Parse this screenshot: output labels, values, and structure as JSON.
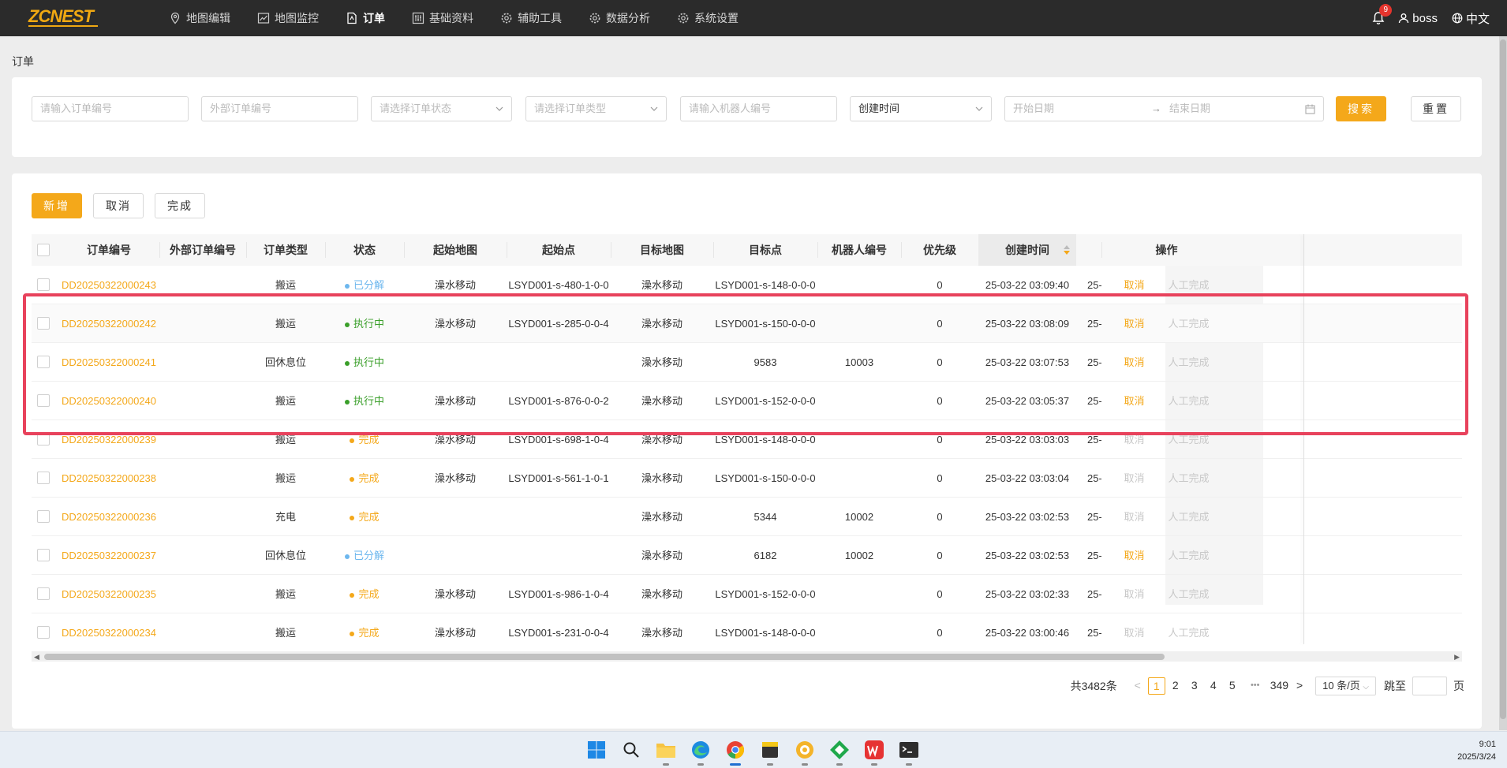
{
  "app": {
    "logo_text": "ZCNEST",
    "brand_color": "#f4a81a"
  },
  "nav": [
    {
      "label": "地图编辑",
      "icon": "map-pin-icon"
    },
    {
      "label": "地图监控",
      "icon": "chart-line-icon"
    },
    {
      "label": "订单",
      "icon": "document-icon",
      "active": true
    },
    {
      "label": "基础资料",
      "icon": "sliders-icon"
    },
    {
      "label": "辅助工具",
      "icon": "gear-icon"
    },
    {
      "label": "数据分析",
      "icon": "gear-icon"
    },
    {
      "label": "系统设置",
      "icon": "gear-icon"
    }
  ],
  "header_right": {
    "notif_count": "9",
    "user": "boss",
    "lang": "中文"
  },
  "breadcrumb": "订单",
  "filters": {
    "order_no": "请输入订单编号",
    "ext_order_no": "外部订单编号",
    "status": "请选择订单状态",
    "type": "请选择订单类型",
    "robot": "请输入机器人编号",
    "time_field": "创建时间",
    "start_date": "开始日期",
    "date_arrow": "→",
    "end_date": "结束日期",
    "search": "搜索",
    "reset": "重置"
  },
  "actions": {
    "add": "新增",
    "cancel": "取消",
    "complete": "完成"
  },
  "table": {
    "headers": [
      "订单编号",
      "外部订单编号",
      "订单类型",
      "状态",
      "起始地图",
      "起始点",
      "目标地图",
      "目标点",
      "机器人编号",
      "优先级",
      "创建时间",
      "",
      "操作"
    ],
    "rows": [
      {
        "order": "DD20250322000243",
        "ext": "",
        "type": "搬运",
        "status": "已分解",
        "status_color": "#6db7ee",
        "smap": "澡水移动",
        "spt": "LSYD001-s-480-1-0-0",
        "tmap": "澡水移动",
        "tpt": "LSYD001-s-148-0-0-0",
        "robot": "",
        "prio": "0",
        "created": "25-03-22 03:09:40",
        "trunc": "25-",
        "cancel": "取消",
        "cancel_active": true,
        "manual": "人工完成"
      },
      {
        "order": "DD20250322000242",
        "ext": "",
        "type": "搬运",
        "status": "执行中",
        "status_color": "#3a9f2a",
        "smap": "澡水移动",
        "spt": "LSYD001-s-285-0-0-4",
        "tmap": "澡水移动",
        "tpt": "LSYD001-s-150-0-0-0",
        "robot": "",
        "prio": "0",
        "created": "25-03-22 03:08:09",
        "trunc": "25-",
        "cancel": "取消",
        "cancel_active": true,
        "manual": "人工完成"
      },
      {
        "order": "DD20250322000241",
        "ext": "",
        "type": "回休息位",
        "status": "执行中",
        "status_color": "#3a9f2a",
        "smap": "",
        "spt": "",
        "tmap": "澡水移动",
        "tpt": "9583",
        "robot": "10003",
        "prio": "0",
        "created": "25-03-22 03:07:53",
        "trunc": "25-",
        "cancel": "取消",
        "cancel_active": true,
        "manual": "人工完成"
      },
      {
        "order": "DD20250322000240",
        "ext": "",
        "type": "搬运",
        "status": "执行中",
        "status_color": "#3a9f2a",
        "smap": "澡水移动",
        "spt": "LSYD001-s-876-0-0-2",
        "tmap": "澡水移动",
        "tpt": "LSYD001-s-152-0-0-0",
        "robot": "",
        "prio": "0",
        "created": "25-03-22 03:05:37",
        "trunc": "25-",
        "cancel": "取消",
        "cancel_active": true,
        "manual": "人工完成"
      },
      {
        "order": "DD20250322000239",
        "ext": "",
        "type": "搬运",
        "status": "完成",
        "status_color": "#f4a81a",
        "smap": "澡水移动",
        "spt": "LSYD001-s-698-1-0-4",
        "tmap": "澡水移动",
        "tpt": "LSYD001-s-148-0-0-0",
        "robot": "",
        "prio": "0",
        "created": "25-03-22 03:03:03",
        "trunc": "25-",
        "cancel": "取消",
        "cancel_active": false,
        "manual": "人工完成"
      },
      {
        "order": "DD20250322000238",
        "ext": "",
        "type": "搬运",
        "status": "完成",
        "status_color": "#f4a81a",
        "smap": "澡水移动",
        "spt": "LSYD001-s-561-1-0-1",
        "tmap": "澡水移动",
        "tpt": "LSYD001-s-150-0-0-0",
        "robot": "",
        "prio": "0",
        "created": "25-03-22 03:03:04",
        "trunc": "25-",
        "cancel": "取消",
        "cancel_active": false,
        "manual": "人工完成"
      },
      {
        "order": "DD20250322000236",
        "ext": "",
        "type": "充电",
        "status": "完成",
        "status_color": "#f4a81a",
        "smap": "",
        "spt": "",
        "tmap": "澡水移动",
        "tpt": "5344",
        "robot": "10002",
        "prio": "0",
        "created": "25-03-22 03:02:53",
        "trunc": "25-",
        "cancel": "取消",
        "cancel_active": false,
        "manual": "人工完成"
      },
      {
        "order": "DD20250322000237",
        "ext": "",
        "type": "回休息位",
        "status": "已分解",
        "status_color": "#6db7ee",
        "smap": "",
        "spt": "",
        "tmap": "澡水移动",
        "tpt": "6182",
        "robot": "10002",
        "prio": "0",
        "created": "25-03-22 03:02:53",
        "trunc": "25-",
        "cancel": "取消",
        "cancel_active": true,
        "manual": "人工完成"
      },
      {
        "order": "DD20250322000235",
        "ext": "",
        "type": "搬运",
        "status": "完成",
        "status_color": "#f4a81a",
        "smap": "澡水移动",
        "spt": "LSYD001-s-986-1-0-4",
        "tmap": "澡水移动",
        "tpt": "LSYD001-s-152-0-0-0",
        "robot": "",
        "prio": "0",
        "created": "25-03-22 03:02:33",
        "trunc": "25-",
        "cancel": "取消",
        "cancel_active": false,
        "manual": "人工完成"
      },
      {
        "order": "DD20250322000234",
        "ext": "",
        "type": "搬运",
        "status": "完成",
        "status_color": "#f4a81a",
        "smap": "澡水移动",
        "spt": "LSYD001-s-231-0-0-4",
        "tmap": "澡水移动",
        "tpt": "LSYD001-s-148-0-0-0",
        "robot": "",
        "prio": "0",
        "created": "25-03-22 03:00:46",
        "trunc": "25-",
        "cancel": "取消",
        "cancel_active": false,
        "manual": "人工完成"
      }
    ]
  },
  "pagination": {
    "total": "共3482条",
    "prev": "<",
    "pages": [
      "1",
      "2",
      "3",
      "4",
      "5"
    ],
    "ellipsis": "•••",
    "last": "349",
    "next": ">",
    "page_size": "10 条/页",
    "jump_label": "跳至",
    "page_suffix": "页"
  },
  "taskbar": {
    "icons": [
      "windows-start-icon",
      "search-icon",
      "file-explorer-icon",
      "edge-browser-icon",
      "chrome-browser-icon",
      "sticky-notes-icon",
      "app-icon",
      "app-icon",
      "wps-icon",
      "terminal-icon"
    ],
    "time": "9:01",
    "date": "2025/3/24"
  }
}
